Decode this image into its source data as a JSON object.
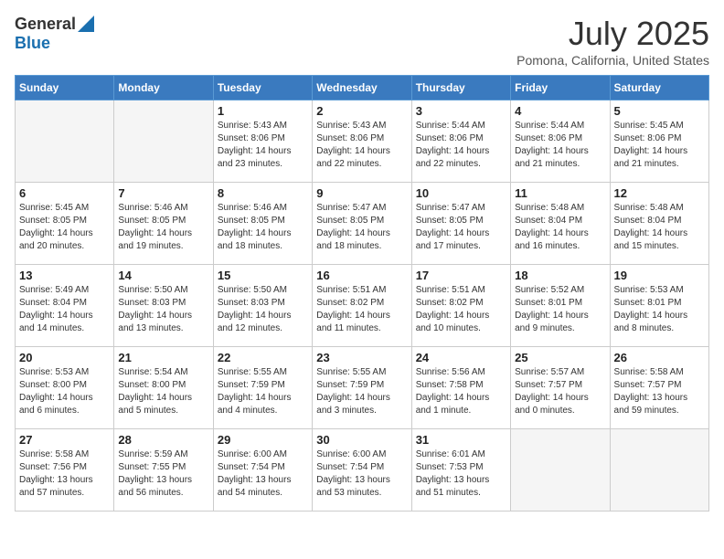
{
  "logo": {
    "general": "General",
    "blue": "Blue"
  },
  "title": "July 2025",
  "location": "Pomona, California, United States",
  "days_of_week": [
    "Sunday",
    "Monday",
    "Tuesday",
    "Wednesday",
    "Thursday",
    "Friday",
    "Saturday"
  ],
  "weeks": [
    [
      {
        "day": "",
        "info": ""
      },
      {
        "day": "",
        "info": ""
      },
      {
        "day": "1",
        "info": "Sunrise: 5:43 AM\nSunset: 8:06 PM\nDaylight: 14 hours and 23 minutes."
      },
      {
        "day": "2",
        "info": "Sunrise: 5:43 AM\nSunset: 8:06 PM\nDaylight: 14 hours and 22 minutes."
      },
      {
        "day": "3",
        "info": "Sunrise: 5:44 AM\nSunset: 8:06 PM\nDaylight: 14 hours and 22 minutes."
      },
      {
        "day": "4",
        "info": "Sunrise: 5:44 AM\nSunset: 8:06 PM\nDaylight: 14 hours and 21 minutes."
      },
      {
        "day": "5",
        "info": "Sunrise: 5:45 AM\nSunset: 8:06 PM\nDaylight: 14 hours and 21 minutes."
      }
    ],
    [
      {
        "day": "6",
        "info": "Sunrise: 5:45 AM\nSunset: 8:05 PM\nDaylight: 14 hours and 20 minutes."
      },
      {
        "day": "7",
        "info": "Sunrise: 5:46 AM\nSunset: 8:05 PM\nDaylight: 14 hours and 19 minutes."
      },
      {
        "day": "8",
        "info": "Sunrise: 5:46 AM\nSunset: 8:05 PM\nDaylight: 14 hours and 18 minutes."
      },
      {
        "day": "9",
        "info": "Sunrise: 5:47 AM\nSunset: 8:05 PM\nDaylight: 14 hours and 18 minutes."
      },
      {
        "day": "10",
        "info": "Sunrise: 5:47 AM\nSunset: 8:05 PM\nDaylight: 14 hours and 17 minutes."
      },
      {
        "day": "11",
        "info": "Sunrise: 5:48 AM\nSunset: 8:04 PM\nDaylight: 14 hours and 16 minutes."
      },
      {
        "day": "12",
        "info": "Sunrise: 5:48 AM\nSunset: 8:04 PM\nDaylight: 14 hours and 15 minutes."
      }
    ],
    [
      {
        "day": "13",
        "info": "Sunrise: 5:49 AM\nSunset: 8:04 PM\nDaylight: 14 hours and 14 minutes."
      },
      {
        "day": "14",
        "info": "Sunrise: 5:50 AM\nSunset: 8:03 PM\nDaylight: 14 hours and 13 minutes."
      },
      {
        "day": "15",
        "info": "Sunrise: 5:50 AM\nSunset: 8:03 PM\nDaylight: 14 hours and 12 minutes."
      },
      {
        "day": "16",
        "info": "Sunrise: 5:51 AM\nSunset: 8:02 PM\nDaylight: 14 hours and 11 minutes."
      },
      {
        "day": "17",
        "info": "Sunrise: 5:51 AM\nSunset: 8:02 PM\nDaylight: 14 hours and 10 minutes."
      },
      {
        "day": "18",
        "info": "Sunrise: 5:52 AM\nSunset: 8:01 PM\nDaylight: 14 hours and 9 minutes."
      },
      {
        "day": "19",
        "info": "Sunrise: 5:53 AM\nSunset: 8:01 PM\nDaylight: 14 hours and 8 minutes."
      }
    ],
    [
      {
        "day": "20",
        "info": "Sunrise: 5:53 AM\nSunset: 8:00 PM\nDaylight: 14 hours and 6 minutes."
      },
      {
        "day": "21",
        "info": "Sunrise: 5:54 AM\nSunset: 8:00 PM\nDaylight: 14 hours and 5 minutes."
      },
      {
        "day": "22",
        "info": "Sunrise: 5:55 AM\nSunset: 7:59 PM\nDaylight: 14 hours and 4 minutes."
      },
      {
        "day": "23",
        "info": "Sunrise: 5:55 AM\nSunset: 7:59 PM\nDaylight: 14 hours and 3 minutes."
      },
      {
        "day": "24",
        "info": "Sunrise: 5:56 AM\nSunset: 7:58 PM\nDaylight: 14 hours and 1 minute."
      },
      {
        "day": "25",
        "info": "Sunrise: 5:57 AM\nSunset: 7:57 PM\nDaylight: 14 hours and 0 minutes."
      },
      {
        "day": "26",
        "info": "Sunrise: 5:58 AM\nSunset: 7:57 PM\nDaylight: 13 hours and 59 minutes."
      }
    ],
    [
      {
        "day": "27",
        "info": "Sunrise: 5:58 AM\nSunset: 7:56 PM\nDaylight: 13 hours and 57 minutes."
      },
      {
        "day": "28",
        "info": "Sunrise: 5:59 AM\nSunset: 7:55 PM\nDaylight: 13 hours and 56 minutes."
      },
      {
        "day": "29",
        "info": "Sunrise: 6:00 AM\nSunset: 7:54 PM\nDaylight: 13 hours and 54 minutes."
      },
      {
        "day": "30",
        "info": "Sunrise: 6:00 AM\nSunset: 7:54 PM\nDaylight: 13 hours and 53 minutes."
      },
      {
        "day": "31",
        "info": "Sunrise: 6:01 AM\nSunset: 7:53 PM\nDaylight: 13 hours and 51 minutes."
      },
      {
        "day": "",
        "info": ""
      },
      {
        "day": "",
        "info": ""
      }
    ]
  ]
}
